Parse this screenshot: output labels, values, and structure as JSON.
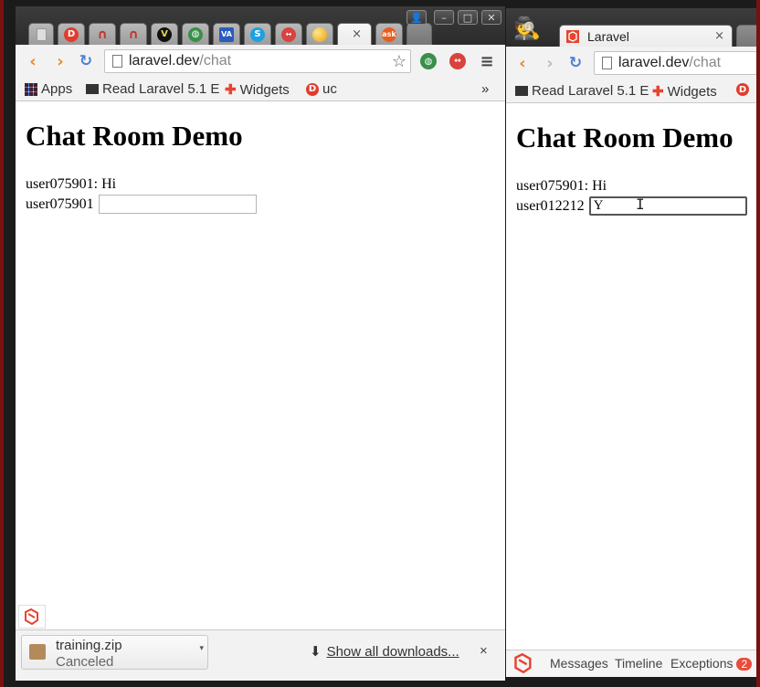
{
  "left_window": {
    "tabs": [
      {
        "icon": "blank-page-icon"
      },
      {
        "icon": "disqus-icon"
      },
      {
        "icon": "redis-icon"
      },
      {
        "icon": "redis-icon"
      },
      {
        "icon": "vim-icon"
      },
      {
        "icon": "globe-icon"
      },
      {
        "icon": "vagrant-icon"
      },
      {
        "icon": "skype-icon"
      },
      {
        "icon": "lastpass-icon"
      },
      {
        "icon": "yellow-ball-icon"
      },
      {
        "icon": "blank-active-icon",
        "active": true
      },
      {
        "icon": "ask-icon",
        "label": "ask"
      }
    ],
    "tab_close": "×",
    "address": {
      "host": "laravel.dev",
      "path": "/chat"
    },
    "bookmarks": [
      {
        "icon": "apps-grid-icon",
        "label": "Apps"
      },
      {
        "icon": "book-icon",
        "label": "Read Laravel 5.1 E"
      },
      {
        "icon": "puzzle-icon",
        "label": "Widgets"
      },
      {
        "icon": "disqus-icon",
        "label": "uc"
      }
    ],
    "bookmarks_overflow": "»",
    "page": {
      "title": "Chat Room Demo",
      "messages": [
        {
          "user": "user075901",
          "text": "Hi"
        }
      ],
      "current_user": "user075901",
      "input_value": ""
    },
    "downloads": {
      "file_name": "training.zip",
      "status": "Canceled",
      "show_all": "Show all downloads...",
      "close": "×"
    }
  },
  "right_window": {
    "tab_title": "Laravel",
    "tab_close": "×",
    "address": {
      "host": "laravel.dev",
      "path": "/chat"
    },
    "bookmarks": [
      {
        "icon": "book-icon",
        "label": "Read Laravel 5.1 E"
      },
      {
        "icon": "puzzle-icon",
        "label": "Widgets"
      }
    ],
    "page": {
      "title": "Chat Room Demo",
      "messages": [
        {
          "user": "user075901",
          "text": "Hi"
        }
      ],
      "current_user": "user012212",
      "input_value": "Y"
    },
    "debugbar": {
      "messages": "Messages",
      "timeline": "Timeline",
      "exceptions": "Exceptions",
      "exceptions_count": "2"
    }
  },
  "colors": {
    "laravel_red": "#e74430",
    "nav_orange": "#e8872a",
    "reload_blue": "#4a7fd6",
    "frame_red": "#7a1010"
  }
}
